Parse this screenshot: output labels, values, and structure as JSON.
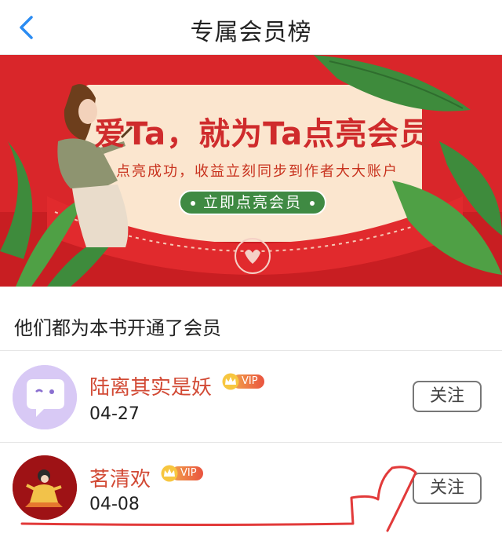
{
  "header": {
    "back_icon": "chevron-left-icon",
    "title": "专属会员榜"
  },
  "banner": {
    "headline": "爱Ta，就为Ta点亮会员",
    "subline": "点亮成功，收益立刻同步到作者大大账户",
    "cta": "立即点亮会员"
  },
  "section": {
    "title": "他们都为本书开通了会员"
  },
  "members": [
    {
      "name": "陆离其实是妖",
      "badge": "VIP",
      "date": "04-27",
      "follow": "关注"
    },
    {
      "name": "茗清欢",
      "badge": "VIP",
      "date": "04-08",
      "follow": "关注"
    }
  ],
  "colors": {
    "accent": "#d24a35",
    "banner_red": "#d9262a",
    "cta_green": "#3f8a43"
  }
}
